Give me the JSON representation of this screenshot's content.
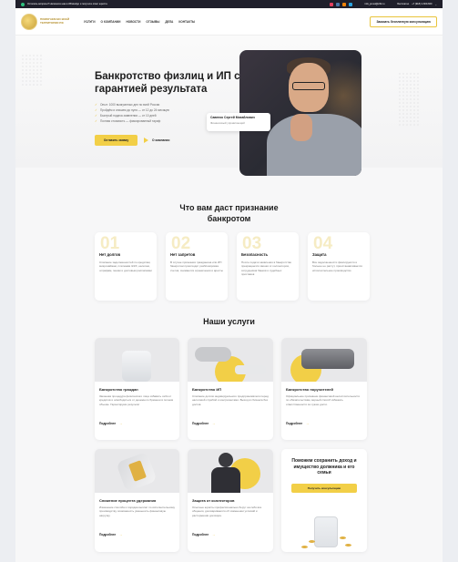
{
  "topbar": {
    "note": "Остались вопросы? Напишите нам в WhatsApp и получите ответ юриста",
    "email": "info_jurust@24k.ru",
    "phone": "+7 (918) 2-600-600",
    "phone_label": "Бесплатно"
  },
  "header": {
    "logo": "Помогаем во всей территории РФ",
    "nav": [
      "Услуги",
      "О компании",
      "Новости",
      "Отзывы",
      "Дела",
      "Контакты"
    ],
    "cta": "Заказать бесплатную консультацию"
  },
  "hero": {
    "title": "Банкротство физлиц и ИП с гарантией результата",
    "benefits": [
      "Опыт: 1000 выигранных дел по всей России",
      "Пройдём и спишем до нуля — от 12 до 24 месяцев",
      "Быстрый подача заявления — от 10 дней",
      "Полная стоимость — фиксированный тариф"
    ],
    "cta": "Оставить заявку",
    "about": "О компании",
    "person_name": "Савенко Сергей Михайлович",
    "person_role": "Финансовый управляющий"
  },
  "benefits_section": {
    "title": "Что вам даст признание банкротом",
    "items": [
      {
        "num": "01",
        "title": "Нет долгов",
        "text": "Списание задолженностей по кредитам, микрозаймам, платежам ЖКХ, налогам, штрафам, пеням и долговым расписками"
      },
      {
        "num": "02",
        "title": "Нет запретов",
        "text": "В случае признания гражданина или ИП банкротом происходит разблокировка счетов, снимаются ограничения и аресты"
      },
      {
        "num": "03",
        "title": "Безопасность",
        "text": "После подачи заявления в банкротство прекращается звонки от коллекторов, сотрудников банков и судебных приставов"
      },
      {
        "num": "04",
        "title": "Защита",
        "text": "Все задолженности фиксируются и больше не растут, приостанавливается исполнительное производство"
      }
    ]
  },
  "services": {
    "title": "Наши услуги",
    "more": "Подробнее",
    "items": [
      {
        "title": "Банкротство граждан",
        "text": "Законная процедура физического лица избавить себя от кредитов и освободиться от денежного бремени в полном объеме. Гарантируем результат"
      },
      {
        "title": "Банкротство ИП",
        "text": "Списание долгов индивидуального предпринимателя перед налоговой службой и контрагентами. Выход из бизнеса без долгов."
      },
      {
        "title": "Банкротство поручителей",
        "text": "Официальное признание финансовой несостоятельности по обязательствам, верный способ избежать ответственности за чужие долги."
      },
      {
        "title": "Снижение процента удержания",
        "text": "Изменение способа и порядка выплат по исполнительному производству, возможность уменьшить финансовую нагрузку."
      },
      {
        "title": "Защита от коллекторов",
        "text": "Опытные юристы профессионально берут на себя все общения, договариваются об изменении условий и расторжении договора."
      }
    ],
    "promo_title": "Поможем сохранить доход и имущество должника и его семьи",
    "promo_cta": "Получить консультацию"
  }
}
